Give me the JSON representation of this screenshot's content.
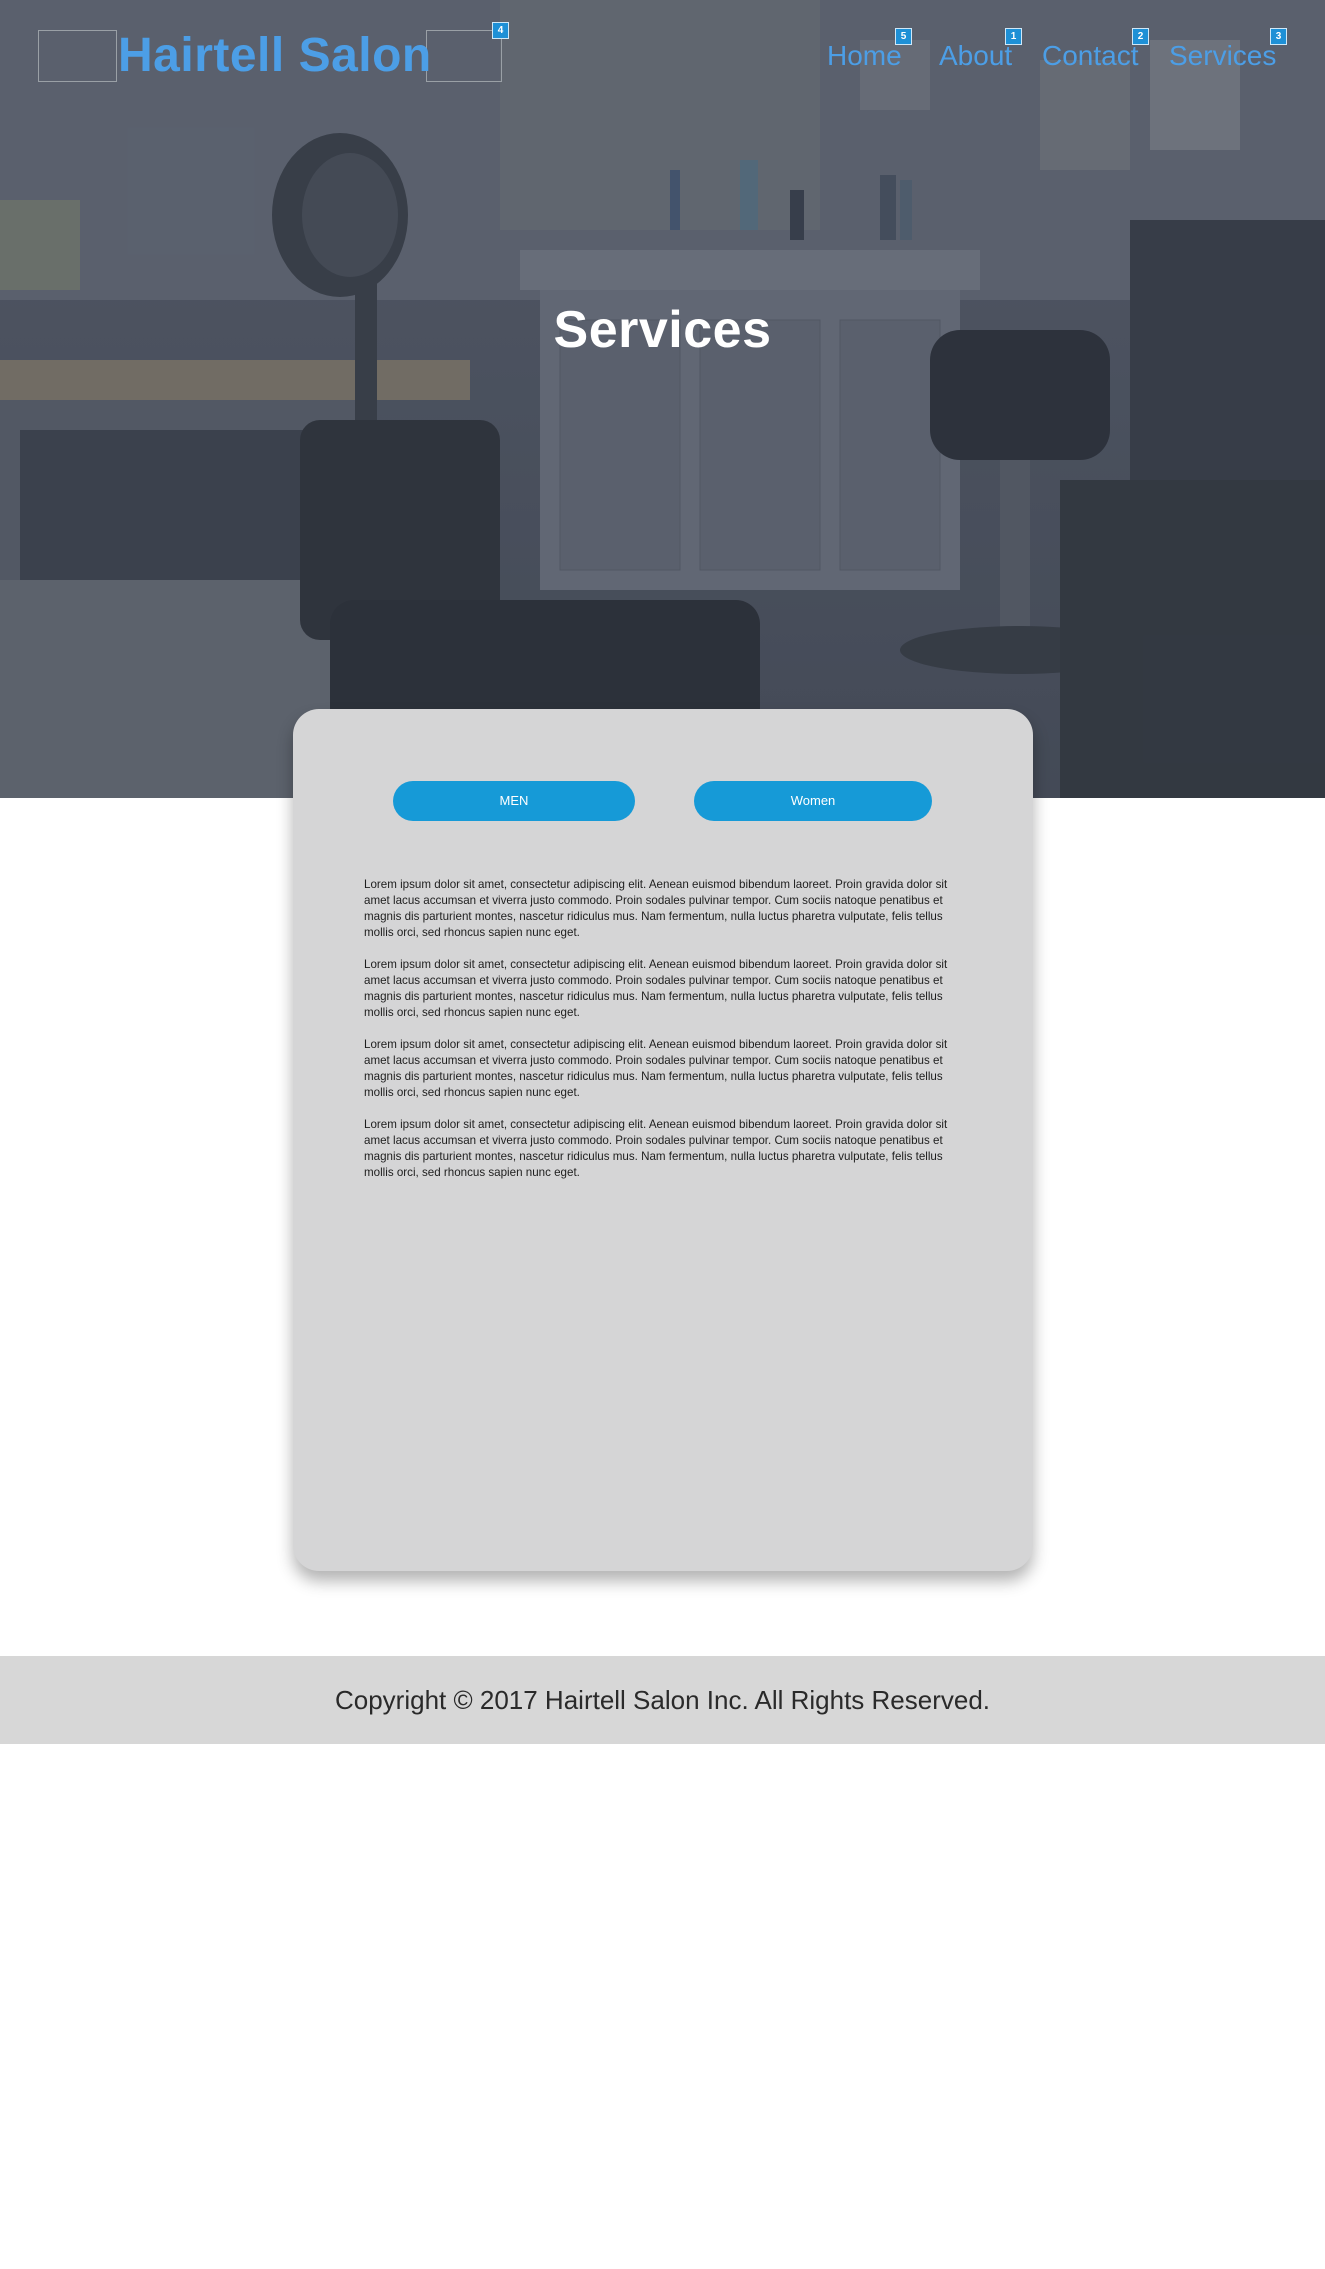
{
  "brand": {
    "logo_text": "Hairtell Salon",
    "logo_badge": "4",
    "accent_color": "#4c9ee6"
  },
  "nav": {
    "items": [
      {
        "label": "Home",
        "badge": "5"
      },
      {
        "label": "About",
        "badge": "1"
      },
      {
        "label": "Contact",
        "badge": "2"
      },
      {
        "label": "Services",
        "badge": "3"
      }
    ]
  },
  "hero": {
    "title": "Services",
    "background_image": "salon-interior-photo"
  },
  "card": {
    "buttons": {
      "men_label": "MEN",
      "women_label": "Women",
      "button_color": "#169ad7"
    },
    "paragraphs": [
      "Lorem ipsum dolor sit amet, consectetur adipiscing elit. Aenean euismod bibendum laoreet. Proin gravida dolor sit amet lacus accumsan et viverra justo commodo. Proin sodales pulvinar tempor. Cum sociis natoque penatibus et magnis dis parturient montes, nascetur ridiculus mus. Nam fermentum, nulla luctus pharetra vulputate, felis tellus mollis orci, sed rhoncus sapien nunc eget.",
      "Lorem ipsum dolor sit amet, consectetur adipiscing elit. Aenean euismod bibendum laoreet. Proin gravida dolor sit amet lacus accumsan et viverra justo commodo. Proin sodales pulvinar tempor. Cum sociis natoque penatibus et magnis dis parturient montes, nascetur ridiculus mus. Nam fermentum, nulla luctus pharetra vulputate, felis tellus mollis orci, sed rhoncus sapien nunc eget.",
      "Lorem ipsum dolor sit amet, consectetur adipiscing elit. Aenean euismod bibendum laoreet. Proin gravida dolor sit amet lacus accumsan et viverra justo commodo. Proin sodales pulvinar tempor. Cum sociis natoque penatibus et magnis dis parturient montes, nascetur ridiculus mus. Nam fermentum, nulla luctus pharetra vulputate, felis tellus mollis orci, sed rhoncus sapien nunc eget.",
      "Lorem ipsum dolor sit amet, consectetur adipiscing elit. Aenean euismod bibendum laoreet. Proin gravida dolor sit amet lacus accumsan et viverra justo commodo. Proin sodales pulvinar tempor. Cum sociis natoque penatibus et magnis dis parturient montes, nascetur ridiculus mus. Nam fermentum, nulla luctus pharetra vulputate, felis tellus mollis orci, sed rhoncus sapien nunc eget."
    ]
  },
  "footer": {
    "copyright": "Copyright © 2017 Hairtell Salon Inc. All Rights Reserved."
  }
}
